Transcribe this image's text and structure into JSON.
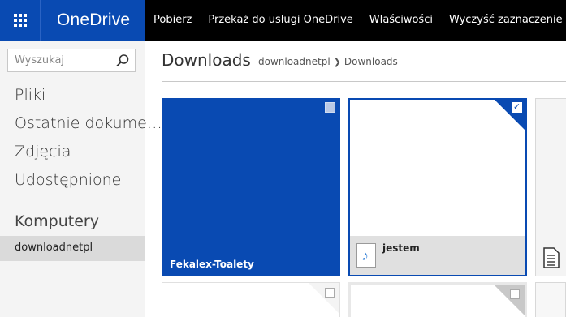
{
  "app": {
    "name": "OneDrive",
    "brand_color": "#094ab2"
  },
  "commands": [
    {
      "label": "Pobierz"
    },
    {
      "label": "Przekaż do usługi OneDrive"
    },
    {
      "label": "Właściwości"
    },
    {
      "label": "Wyczyść zaznaczenie"
    }
  ],
  "sidebar": {
    "search_placeholder": "Wyszukaj",
    "items": [
      {
        "label": "Pliki"
      },
      {
        "label": "Ostatnie dokume…"
      },
      {
        "label": "Zdjęcia"
      },
      {
        "label": "Udostępnione"
      }
    ],
    "section_title": "Komputery",
    "computer": "downloadnetpl"
  },
  "main": {
    "title": "Downloads",
    "breadcrumb": [
      "downloadnetpl",
      "Downloads"
    ],
    "tiles": [
      {
        "name": "Fekalex-Toalety",
        "kind": "folder",
        "selected": false
      },
      {
        "name": "jestem",
        "kind": "audio-file",
        "selected": true,
        "check_mark": "✓",
        "icon": "music-note-icon"
      }
    ]
  }
}
